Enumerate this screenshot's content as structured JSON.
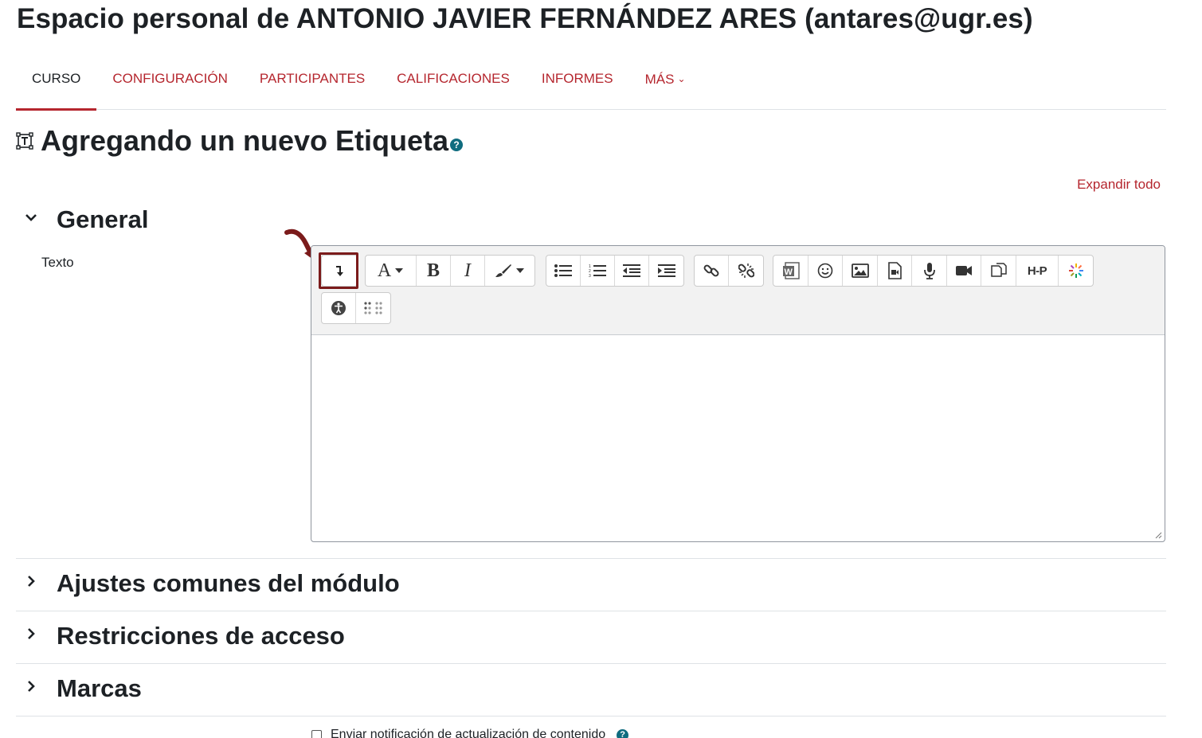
{
  "header": {
    "prefix": "Espacio personal de",
    "name": "ANTONIO JAVIER FERNÁNDEZ ARES (antares@ugr.es)"
  },
  "nav": {
    "items": [
      {
        "label": "CURSO",
        "active": true
      },
      {
        "label": "CONFIGURACIÓN"
      },
      {
        "label": "PARTICIPANTES"
      },
      {
        "label": "CALIFICACIONES"
      },
      {
        "label": "INFORMES"
      },
      {
        "label": "MÁS"
      }
    ]
  },
  "activity": {
    "icon": "label-icon",
    "title": "Agregando un nuevo Etiqueta",
    "help_icon": "help-icon",
    "help_glyph": "?"
  },
  "expand_all": "Expandir todo",
  "sections": {
    "general": "General",
    "module_settings": "Ajustes comunes del módulo",
    "access": "Restricciones de acceso",
    "tags": "Marcas"
  },
  "form": {
    "text_label": "Texto",
    "text_value": ""
  },
  "toolbar": {
    "highlighted_button": "show-more-buttons",
    "row1_icons": [
      "show-more-icon",
      "font-style-icon",
      "bold-icon",
      "italic-icon",
      "paint-brush-icon",
      "unordered-list-icon",
      "ordered-list-icon",
      "outdent-icon",
      "indent-icon",
      "link-icon",
      "unlink-icon",
      "word-import-icon",
      "emoji-icon",
      "image-icon",
      "media-icon",
      "record-audio-icon",
      "record-video-icon",
      "manage-files-icon",
      "h5p-icon",
      "kaltura-icon"
    ],
    "row2_icons": [
      "accessibility-checker-icon",
      "screenreader-helper-icon"
    ],
    "labels": {
      "bold": "B",
      "italic": "I",
      "font": "A",
      "h5p": "H-P",
      "word": "W"
    }
  },
  "notify": {
    "label": "Enviar notificación de actualización de contenido",
    "checked": false
  },
  "colors": {
    "accent": "#b5262e",
    "help": "#0f6c7f",
    "highlight": "#7b1b1b"
  }
}
